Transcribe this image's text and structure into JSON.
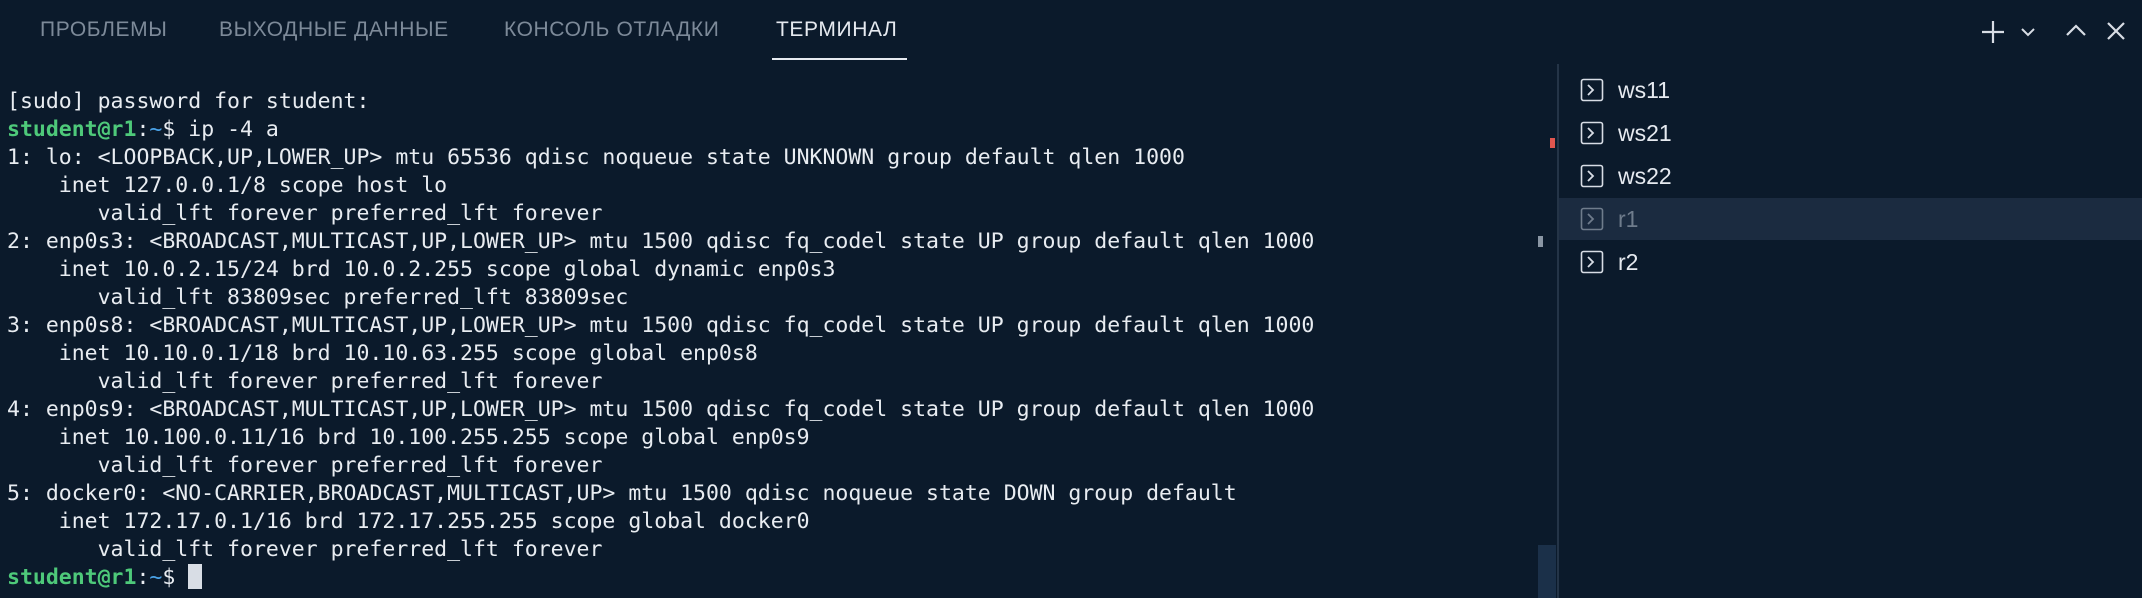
{
  "tabs": [
    {
      "label": "ПРОБЛЕМЫ",
      "active": false
    },
    {
      "label": "ВЫХОДНЫЕ ДАННЫЕ",
      "active": false
    },
    {
      "label": "КОНСОЛЬ ОТЛАДКИ",
      "active": false
    },
    {
      "label": "ТЕРМИНАЛ",
      "active": true
    }
  ],
  "toolbar": {
    "icons": [
      "plus-icon",
      "chevron-down-icon",
      "chevron-up-icon",
      "close-icon"
    ]
  },
  "terminal": {
    "prompt_user": "student@r1",
    "prompt_sep": ":",
    "prompt_path": "~",
    "prompt_symbol": "$ ",
    "command": "ip -4 a",
    "lines_before_prompt": [
      "[sudo] password for student:"
    ],
    "output": [
      "1: lo: <LOOPBACK,UP,LOWER_UP> mtu 65536 qdisc noqueue state UNKNOWN group default qlen 1000",
      "    inet 127.0.0.1/8 scope host lo",
      "       valid_lft forever preferred_lft forever",
      "2: enp0s3: <BROADCAST,MULTICAST,UP,LOWER_UP> mtu 1500 qdisc fq_codel state UP group default qlen 1000",
      "    inet 10.0.2.15/24 brd 10.0.2.255 scope global dynamic enp0s3",
      "       valid_lft 83809sec preferred_lft 83809sec",
      "3: enp0s8: <BROADCAST,MULTICAST,UP,LOWER_UP> mtu 1500 qdisc fq_codel state UP group default qlen 1000",
      "    inet 10.10.0.1/18 brd 10.10.63.255 scope global enp0s8",
      "       valid_lft forever preferred_lft forever",
      "4: enp0s9: <BROADCAST,MULTICAST,UP,LOWER_UP> mtu 1500 qdisc fq_codel state UP group default qlen 1000",
      "    inet 10.100.0.11/16 brd 10.100.255.255 scope global enp0s9",
      "       valid_lft forever preferred_lft forever",
      "5: docker0: <NO-CARRIER,BROADCAST,MULTICAST,UP> mtu 1500 qdisc noqueue state DOWN group default",
      "    inet 172.17.0.1/16 brd 172.17.255.255 scope global docker0",
      "       valid_lft forever preferred_lft forever"
    ]
  },
  "terminal_tabs": [
    {
      "label": "ws11",
      "selected": false
    },
    {
      "label": "ws21",
      "selected": false
    },
    {
      "label": "ws22",
      "selected": false
    },
    {
      "label": "r1",
      "selected": true
    },
    {
      "label": "r2",
      "selected": false
    }
  ],
  "colors": {
    "background": "#0b1a2b",
    "prompt_user": "#4ec97a",
    "prompt_path": "#4aa3e8",
    "selected_row": "#1b2b40",
    "ruler_error": "#e0564f"
  }
}
